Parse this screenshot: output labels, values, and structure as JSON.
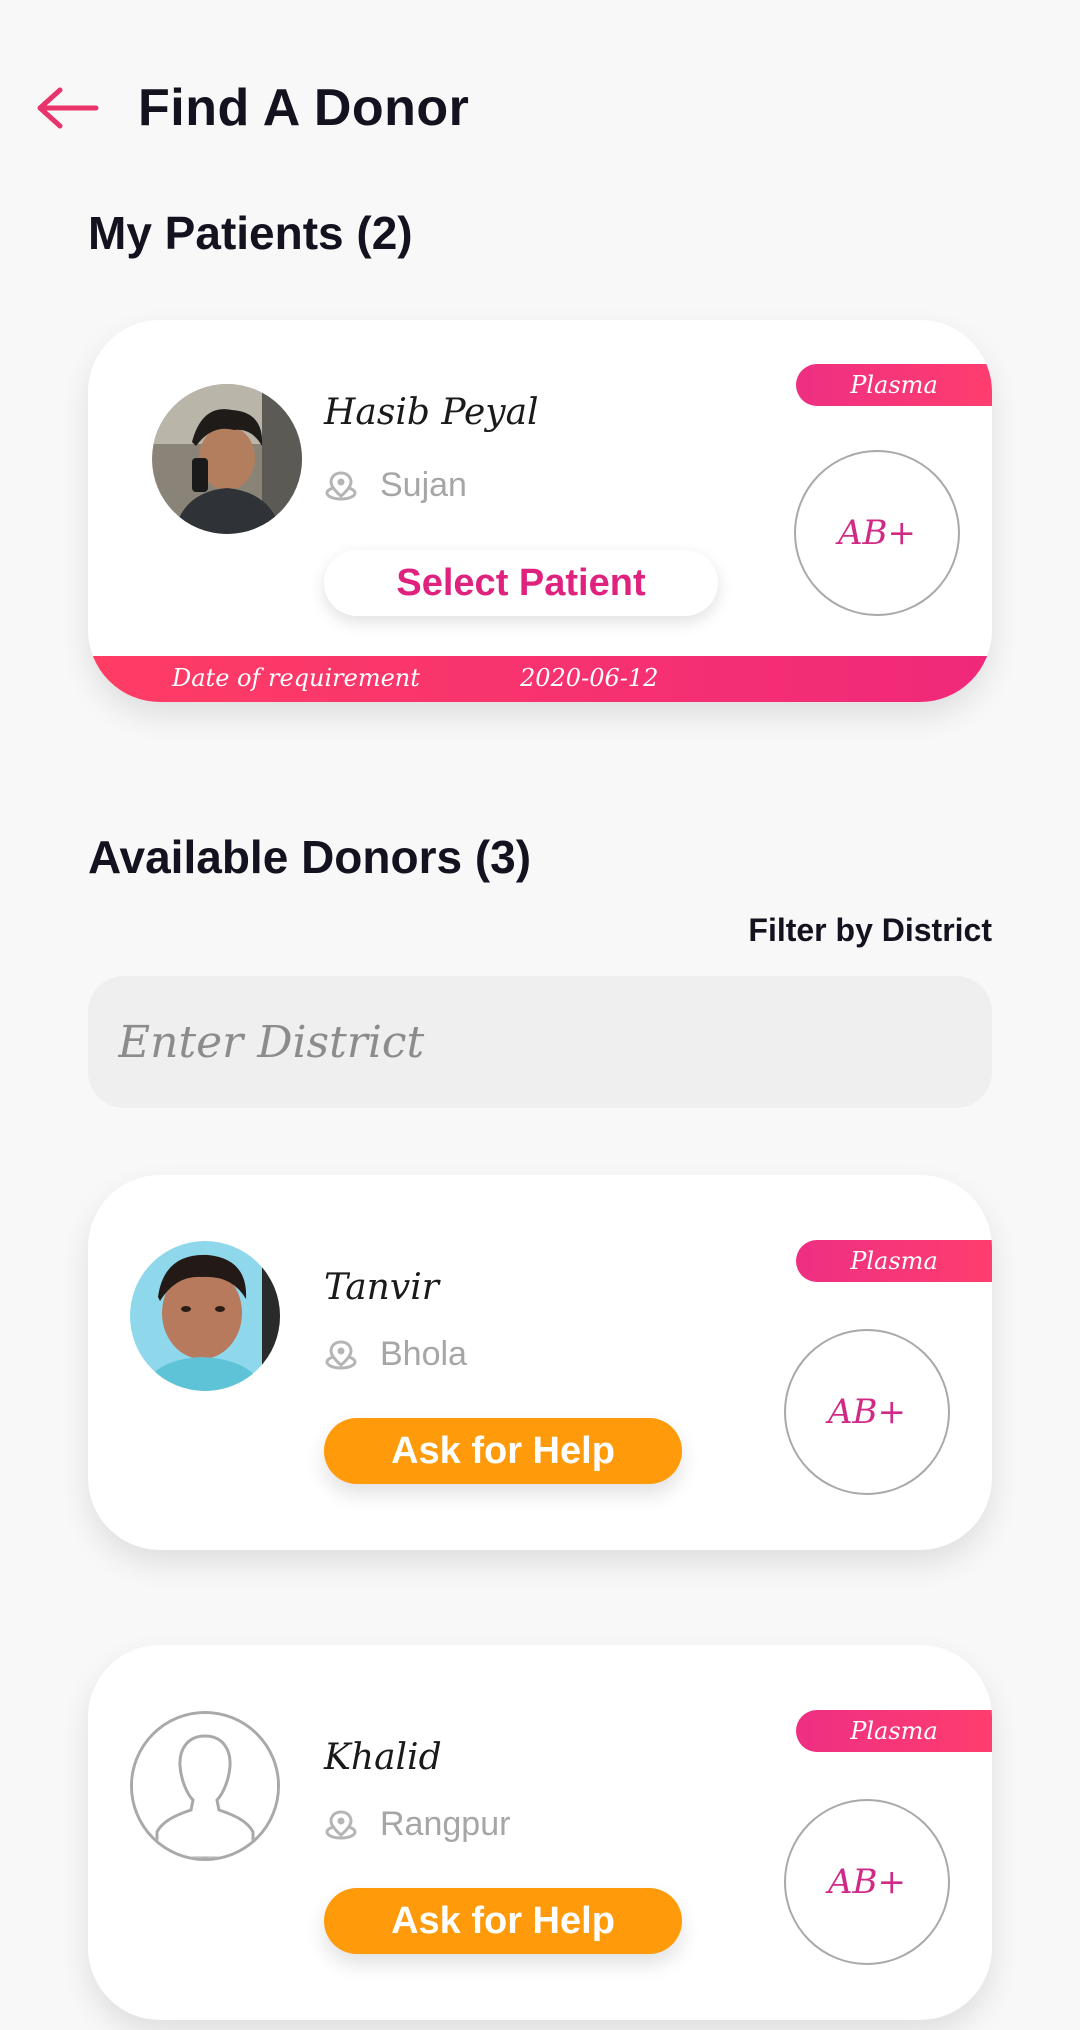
{
  "header": {
    "title": "Find A Donor"
  },
  "my_patients": {
    "title": "My Patients (2)",
    "patient": {
      "name": "Hasib Peyal",
      "location": "Sujan",
      "badge": "Plasma",
      "blood_group": "AB+",
      "select_label": "Select Patient",
      "requirement_label": "Date of requirement",
      "requirement_date": "2020-06-12"
    }
  },
  "donors": {
    "title": "Available Donors (3)",
    "filter_label": "Filter by District",
    "filter_placeholder": "Enter District",
    "items": [
      {
        "name": "Tanvir",
        "location": "Bhola",
        "badge": "Plasma",
        "blood_group": "AB+",
        "action": "Ask for Help"
      },
      {
        "name": "Khalid",
        "location": "Rangpur",
        "badge": "Plasma",
        "blood_group": "AB+",
        "action": "Ask for Help"
      }
    ]
  },
  "colors": {
    "accent_pink": "#e0227f",
    "accent_orange": "#ff9a0a",
    "back_arrow": "#e8336b"
  }
}
